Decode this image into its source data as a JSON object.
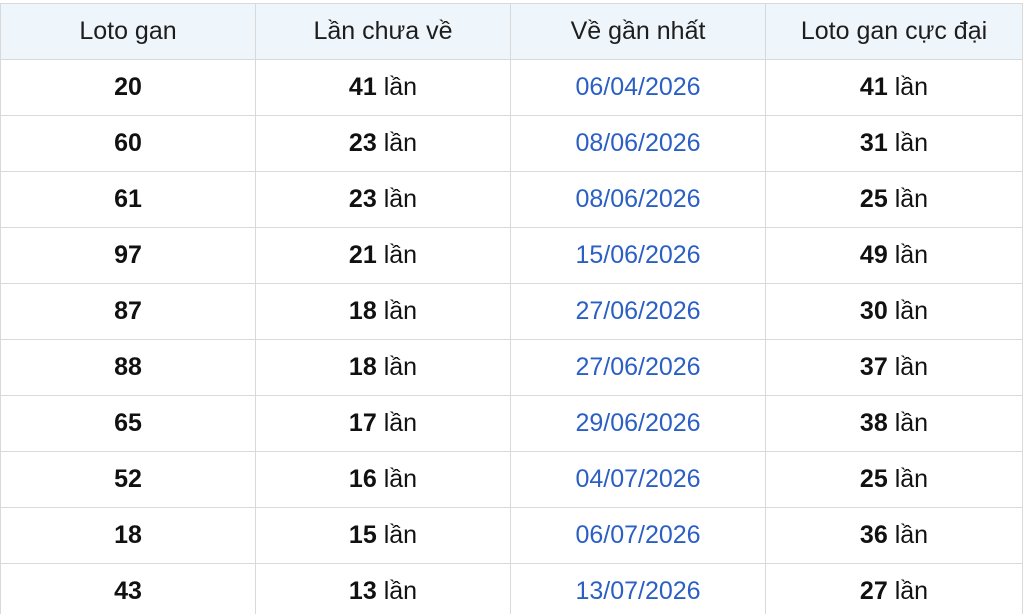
{
  "table": {
    "headers": [
      "Loto gan",
      "Lần chưa về",
      "Về gần nhất",
      "Loto gan cực đại"
    ],
    "unit": "lần",
    "rows": [
      {
        "loto": "20",
        "missed": "41",
        "last": "06/04/2026",
        "max": "41"
      },
      {
        "loto": "60",
        "missed": "23",
        "last": "08/06/2026",
        "max": "31"
      },
      {
        "loto": "61",
        "missed": "23",
        "last": "08/06/2026",
        "max": "25"
      },
      {
        "loto": "97",
        "missed": "21",
        "last": "15/06/2026",
        "max": "49"
      },
      {
        "loto": "87",
        "missed": "18",
        "last": "27/06/2026",
        "max": "30"
      },
      {
        "loto": "88",
        "missed": "18",
        "last": "27/06/2026",
        "max": "37"
      },
      {
        "loto": "65",
        "missed": "17",
        "last": "29/06/2026",
        "max": "38"
      },
      {
        "loto": "52",
        "missed": "16",
        "last": "04/07/2026",
        "max": "25"
      },
      {
        "loto": "18",
        "missed": "15",
        "last": "06/07/2026",
        "max": "36"
      },
      {
        "loto": "43",
        "missed": "13",
        "last": "13/07/2026",
        "max": "27"
      }
    ]
  },
  "colors": {
    "header_bg": "#eef5fb",
    "date_text": "#2b5fc4",
    "border": "#d9d9d9"
  }
}
